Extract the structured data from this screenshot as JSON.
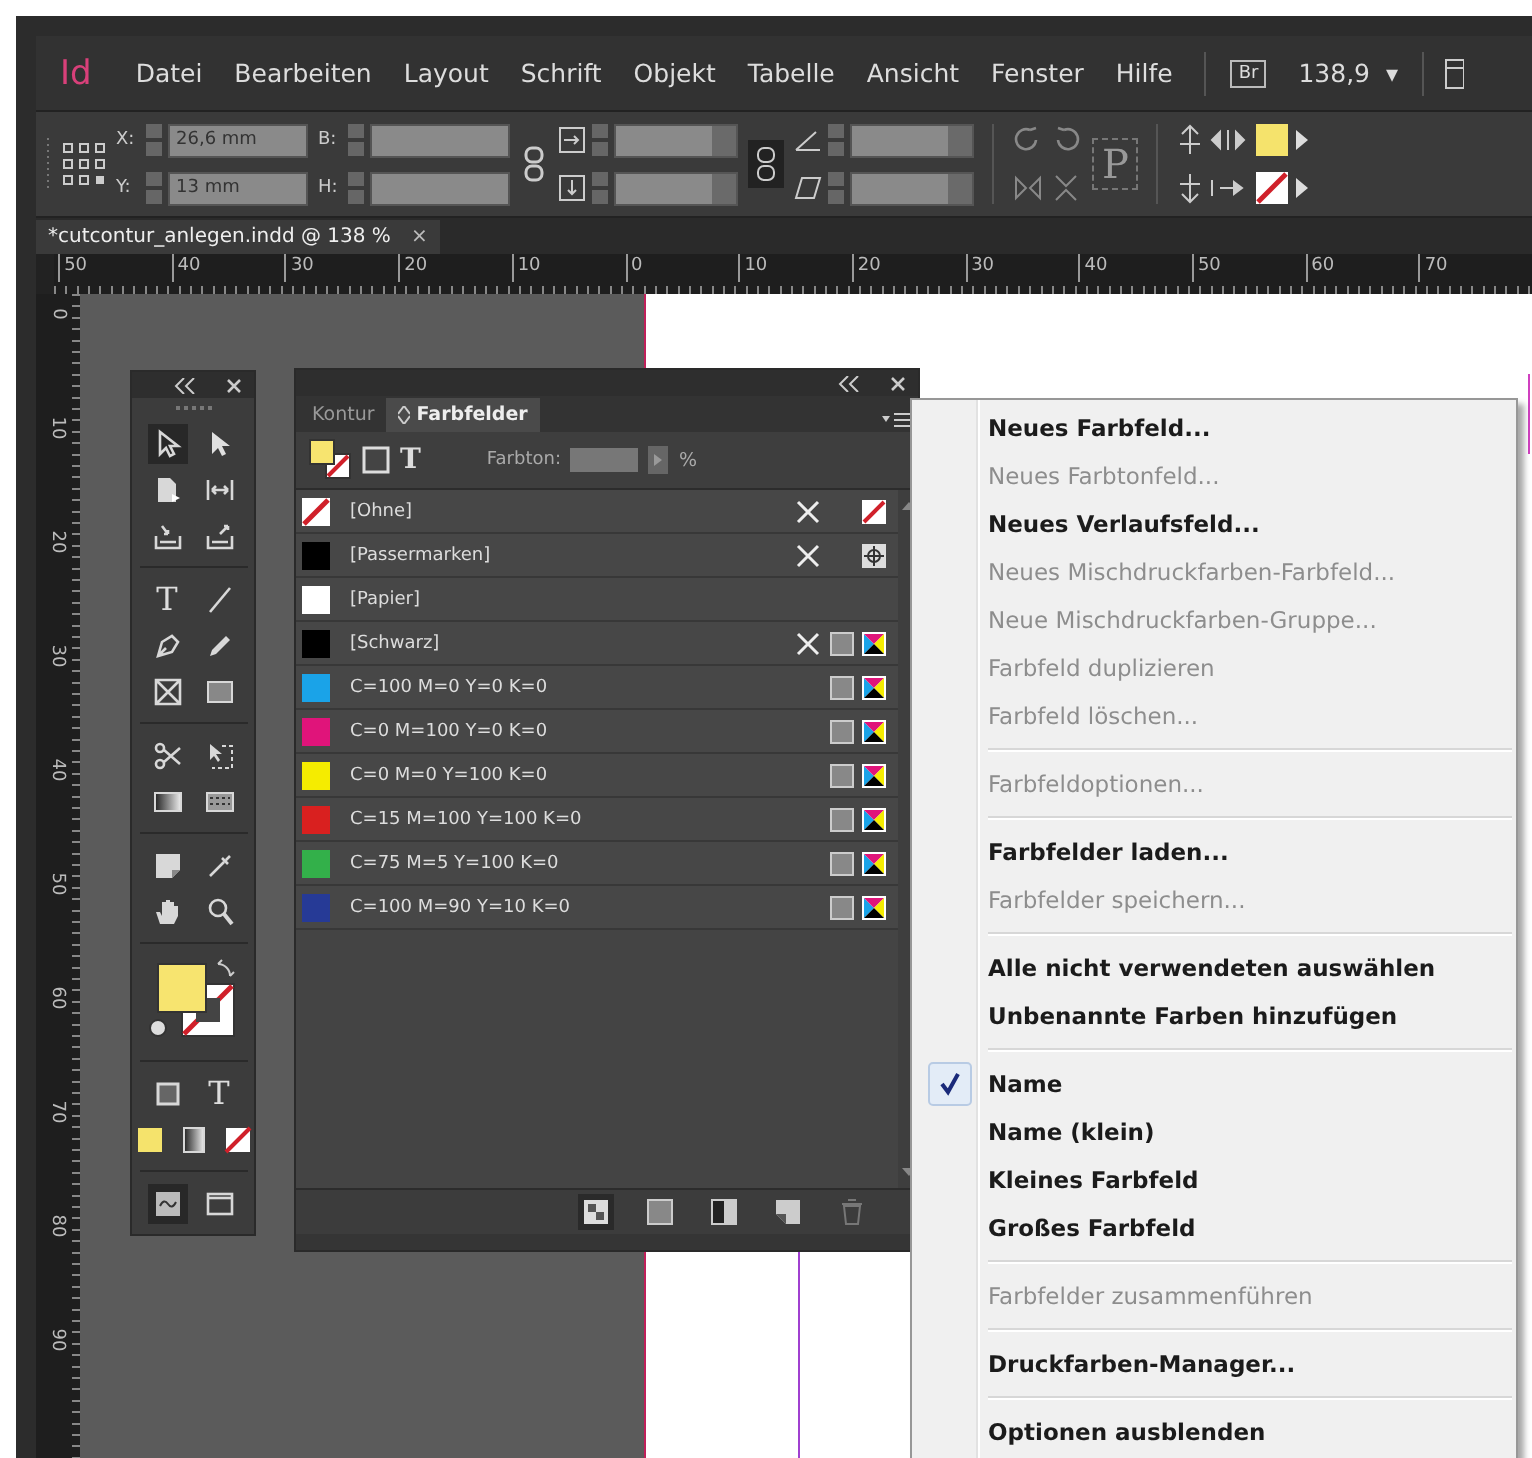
{
  "app": {
    "logo": "Id",
    "menus": [
      "Datei",
      "Bearbeiten",
      "Layout",
      "Schrift",
      "Objekt",
      "Tabelle",
      "Ansicht",
      "Fenster",
      "Hilfe"
    ],
    "bridge": "Br",
    "zoom": "138,9",
    "zoom_caret": "▾"
  },
  "control_bar": {
    "x_label": "X:",
    "x_value": "26,6 mm",
    "y_label": "Y:",
    "y_value": "13 mm",
    "w_label": "B:",
    "h_label": "H:",
    "frame_glyph": "P"
  },
  "document_tab": {
    "title": "*cutcontur_anlegen.indd @ 138 %",
    "close": "×"
  },
  "rulers": {
    "horizontal": [
      "50",
      "40",
      "30",
      "20",
      "10",
      "0",
      "10",
      "20",
      "30",
      "40",
      "50",
      "60",
      "70"
    ],
    "vertical": [
      "0",
      "10",
      "20",
      "30",
      "40",
      "50",
      "60",
      "70",
      "80",
      "90"
    ]
  },
  "tools_panel": {
    "type_glyph": "T",
    "text_format_glyph": "T"
  },
  "swatches_panel": {
    "tabs": [
      {
        "label": "Kontur",
        "selected": false
      },
      {
        "label": "Farbfelder",
        "selected": true
      }
    ],
    "text_toggle": "T",
    "tint_label": "Farbton:",
    "tint_unit": "%",
    "swatches": [
      {
        "name": "[Ohne]",
        "kind": "none",
        "locked": true
      },
      {
        "name": "[Passermarken]",
        "kind": "registration",
        "color": "#000000",
        "locked": true
      },
      {
        "name": "[Papier]",
        "kind": "paper",
        "color": "#ffffff",
        "locked": false
      },
      {
        "name": "[Schwarz]",
        "kind": "process",
        "color": "#000000",
        "locked": true
      },
      {
        "name": "C=100 M=0 Y=0 K=0",
        "kind": "process",
        "color": "#1aa3e8",
        "locked": false
      },
      {
        "name": "C=0 M=100 Y=0 K=0",
        "kind": "process",
        "color": "#e0147a",
        "locked": false
      },
      {
        "name": "C=0 M=0 Y=100 K=0",
        "kind": "process",
        "color": "#f5ec00",
        "locked": false
      },
      {
        "name": "C=15 M=100 Y=100 K=0",
        "kind": "process",
        "color": "#d9201f",
        "locked": false
      },
      {
        "name": "C=75 M=5 Y=100 K=0",
        "kind": "process",
        "color": "#33b04a",
        "locked": false
      },
      {
        "name": "C=100 M=90 Y=10 K=0",
        "kind": "process",
        "color": "#263a96",
        "locked": false
      }
    ]
  },
  "context_menu": {
    "groups": [
      [
        {
          "label": "Neues Farbfeld...",
          "disabled": false,
          "checked": false
        },
        {
          "label": "Neues Farbtonfeld...",
          "disabled": true,
          "checked": false
        },
        {
          "label": "Neues Verlaufsfeld...",
          "disabled": false,
          "checked": false
        },
        {
          "label": "Neues Mischdruckfarben-Farbfeld...",
          "disabled": true,
          "checked": false
        },
        {
          "label": "Neue Mischdruckfarben-Gruppe...",
          "disabled": true,
          "checked": false
        },
        {
          "label": "Farbfeld duplizieren",
          "disabled": true,
          "checked": false
        },
        {
          "label": "Farbfeld löschen...",
          "disabled": true,
          "checked": false
        }
      ],
      [
        {
          "label": "Farbfeldoptionen...",
          "disabled": true,
          "checked": false
        }
      ],
      [
        {
          "label": "Farbfelder laden...",
          "disabled": false,
          "checked": false
        },
        {
          "label": "Farbfelder speichern...",
          "disabled": true,
          "checked": false
        }
      ],
      [
        {
          "label": "Alle nicht verwendeten auswählen",
          "disabled": false,
          "checked": false
        },
        {
          "label": "Unbenannte Farben hinzufügen",
          "disabled": false,
          "checked": false
        }
      ],
      [
        {
          "label": "Name",
          "disabled": false,
          "checked": true
        },
        {
          "label": "Name (klein)",
          "disabled": false,
          "checked": false
        },
        {
          "label": "Kleines Farbfeld",
          "disabled": false,
          "checked": false
        },
        {
          "label": "Großes Farbfeld",
          "disabled": false,
          "checked": false
        }
      ],
      [
        {
          "label": "Farbfelder zusammenführen",
          "disabled": true,
          "checked": false
        }
      ],
      [
        {
          "label": "Druckfarben-Manager...",
          "disabled": false,
          "checked": false
        }
      ],
      [
        {
          "label": "Optionen ausblenden",
          "disabled": false,
          "checked": false
        }
      ]
    ]
  }
}
